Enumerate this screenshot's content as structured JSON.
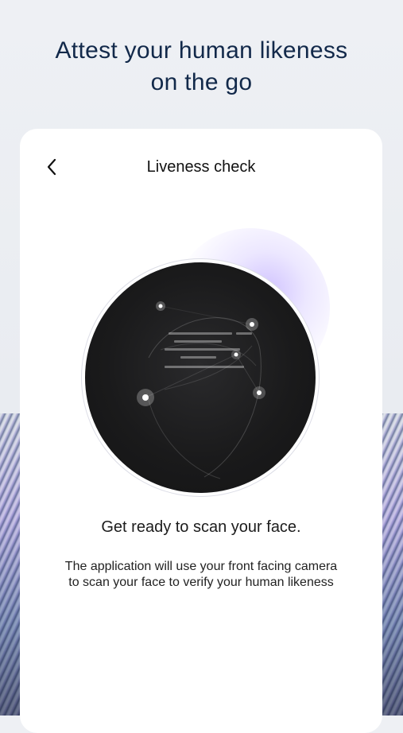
{
  "headline": {
    "line1": "Attest your human likeness",
    "line2": "on the go"
  },
  "card": {
    "back_icon": "chevron-left-icon",
    "title": "Liveness check"
  },
  "scan": {
    "icon": "face-scan-illustration"
  },
  "content": {
    "ready_text": "Get ready to scan your face.",
    "description": "The application will use your front facing camera to scan your face to verify your human likeness"
  },
  "colors": {
    "headline": "#12294a",
    "card_bg": "#ffffff",
    "scan_circle": "#1a1a1b",
    "glow_accent": "#9678ff"
  }
}
